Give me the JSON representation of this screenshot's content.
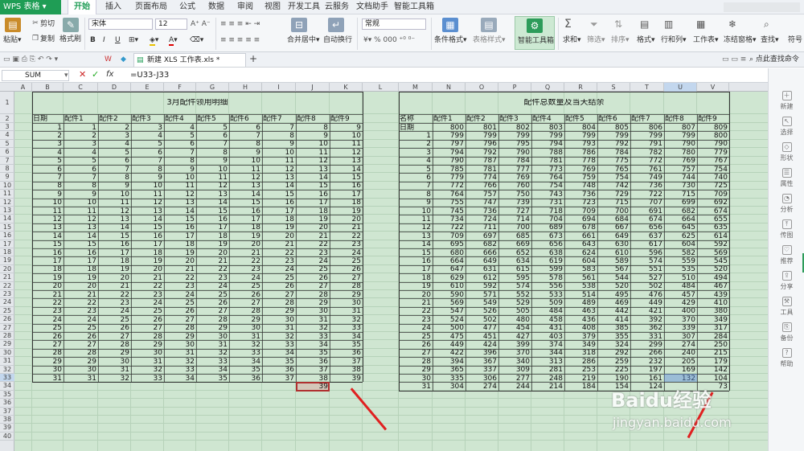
{
  "app": {
    "name": "WPS 表格"
  },
  "menu_tabs": [
    "开始",
    "插入",
    "页面布局",
    "公式",
    "数据",
    "审阅",
    "视图",
    "开发工具",
    "云服务",
    "文档助手",
    "智能工具箱"
  ],
  "ribbon": {
    "paste": "粘贴",
    "cut": "剪切",
    "copy": "复制",
    "format_painter": "格式刷",
    "font": "宋体",
    "font_size": "12",
    "merge": "合并居中",
    "wrap": "自动换行",
    "number_format": "常规",
    "cond_format": "条件格式",
    "table_style": "表格样式",
    "smart_toolbox": "智能工具箱",
    "sum": "求和",
    "filter": "筛选",
    "sort": "排序",
    "format": "格式",
    "rowcol": "行和列",
    "sheet": "工作表",
    "freeze": "冻结窗格",
    "find": "查找",
    "symbol": "符号",
    "percent": "% ",
    "thousands": "000"
  },
  "doc_tab": "新建 XLS 工作表.xls *",
  "search_hint": "点此查找命令",
  "namebox": "SUM",
  "formula": "=U33-J33",
  "columns": [
    "A",
    "B",
    "C",
    "D",
    "E",
    "F",
    "G",
    "H",
    "I",
    "J",
    "K",
    "L",
    "M",
    "N",
    "O",
    "P",
    "Q",
    "R",
    "S",
    "T",
    "U",
    "V"
  ],
  "rows": [
    "1",
    "2",
    "3",
    "4",
    "5",
    "6",
    "7",
    "8",
    "9",
    "10",
    "11",
    "12",
    "13",
    "14",
    "15",
    "16",
    "17",
    "18",
    "19",
    "20",
    "21",
    "22",
    "23",
    "24",
    "25",
    "26",
    "27",
    "28",
    "29",
    "30",
    "31",
    "32",
    "33",
    "34",
    "35",
    "36",
    "37",
    "38",
    "39",
    "40"
  ],
  "left_table": {
    "title": "3月配件领用明细",
    "headers": [
      "日期",
      "配件1",
      "配件2",
      "配件3",
      "配件4",
      "配件5",
      "配件6",
      "配件7",
      "配件8",
      "配件9"
    ]
  },
  "right_table": {
    "title": "配件总数量及当天结余",
    "headers": [
      "名称",
      "配件1",
      "配件2",
      "配件3",
      "配件4",
      "配件5",
      "配件6",
      "配件7",
      "配件8",
      "配件9"
    ],
    "date_label": "日期",
    "first_row": [
      "800",
      "801",
      "802",
      "803",
      "804",
      "805",
      "806",
      "807",
      "809"
    ],
    "rows": [
      [
        "1",
        "799",
        "799",
        "799",
        "799",
        "799",
        "799",
        "799",
        "799",
        "800"
      ],
      [
        "2",
        "797",
        "796",
        "795",
        "794",
        "793",
        "792",
        "791",
        "790",
        "790"
      ],
      [
        "3",
        "794",
        "792",
        "790",
        "788",
        "786",
        "784",
        "782",
        "780",
        "779"
      ],
      [
        "4",
        "790",
        "787",
        "784",
        "781",
        "778",
        "775",
        "772",
        "769",
        "767"
      ],
      [
        "5",
        "785",
        "781",
        "777",
        "773",
        "769",
        "765",
        "761",
        "757",
        "754"
      ],
      [
        "6",
        "779",
        "774",
        "769",
        "764",
        "759",
        "754",
        "749",
        "744",
        "740"
      ],
      [
        "7",
        "772",
        "766",
        "760",
        "754",
        "748",
        "742",
        "736",
        "730",
        "725"
      ],
      [
        "8",
        "764",
        "757",
        "750",
        "743",
        "736",
        "729",
        "722",
        "715",
        "709"
      ],
      [
        "9",
        "755",
        "747",
        "739",
        "731",
        "723",
        "715",
        "707",
        "699",
        "692"
      ],
      [
        "10",
        "745",
        "736",
        "727",
        "718",
        "709",
        "700",
        "691",
        "682",
        "674"
      ],
      [
        "11",
        "734",
        "724",
        "714",
        "704",
        "694",
        "684",
        "674",
        "664",
        "655"
      ],
      [
        "12",
        "722",
        "711",
        "700",
        "689",
        "678",
        "667",
        "656",
        "645",
        "635"
      ],
      [
        "13",
        "709",
        "697",
        "685",
        "673",
        "661",
        "649",
        "637",
        "625",
        "614"
      ],
      [
        "14",
        "695",
        "682",
        "669",
        "656",
        "643",
        "630",
        "617",
        "604",
        "592"
      ],
      [
        "15",
        "680",
        "666",
        "652",
        "638",
        "624",
        "610",
        "596",
        "582",
        "569"
      ],
      [
        "16",
        "664",
        "649",
        "634",
        "619",
        "604",
        "589",
        "574",
        "559",
        "545"
      ],
      [
        "17",
        "647",
        "631",
        "615",
        "599",
        "583",
        "567",
        "551",
        "535",
        "520"
      ],
      [
        "18",
        "629",
        "612",
        "595",
        "578",
        "561",
        "544",
        "527",
        "510",
        "494"
      ],
      [
        "19",
        "610",
        "592",
        "574",
        "556",
        "538",
        "520",
        "502",
        "484",
        "467"
      ],
      [
        "20",
        "590",
        "571",
        "552",
        "533",
        "514",
        "495",
        "476",
        "457",
        "439"
      ],
      [
        "21",
        "569",
        "549",
        "529",
        "509",
        "489",
        "469",
        "449",
        "429",
        "410"
      ],
      [
        "22",
        "547",
        "526",
        "505",
        "484",
        "463",
        "442",
        "421",
        "400",
        "380"
      ],
      [
        "23",
        "524",
        "502",
        "480",
        "458",
        "436",
        "414",
        "392",
        "370",
        "349"
      ],
      [
        "24",
        "500",
        "477",
        "454",
        "431",
        "408",
        "385",
        "362",
        "339",
        "317"
      ],
      [
        "25",
        "475",
        "451",
        "427",
        "403",
        "379",
        "355",
        "331",
        "307",
        "284"
      ],
      [
        "26",
        "449",
        "424",
        "399",
        "374",
        "349",
        "324",
        "299",
        "274",
        "250"
      ],
      [
        "27",
        "422",
        "396",
        "370",
        "344",
        "318",
        "292",
        "266",
        "240",
        "215"
      ],
      [
        "28",
        "394",
        "367",
        "340",
        "313",
        "286",
        "259",
        "232",
        "205",
        "179"
      ],
      [
        "29",
        "365",
        "337",
        "309",
        "281",
        "253",
        "225",
        "197",
        "169",
        "142"
      ],
      [
        "30",
        "335",
        "306",
        "277",
        "248",
        "219",
        "190",
        "161",
        "132",
        "104"
      ],
      [
        "31",
        "304",
        "274",
        "244",
        "214",
        "184",
        "154",
        "124",
        "",
        "73"
      ]
    ]
  },
  "sidebar": [
    "新建",
    "选择",
    "形状",
    "属性",
    "分析",
    "传图",
    "推荐",
    "分享",
    "工具",
    "备份",
    "帮助"
  ],
  "watermark": {
    "main": "Baidu经验",
    "sub": "jingyan.baidu.com"
  }
}
